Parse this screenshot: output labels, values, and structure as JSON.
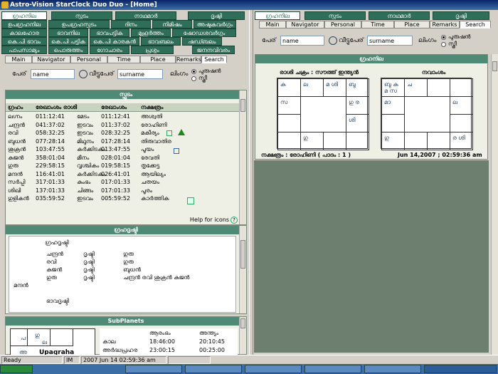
{
  "window": {
    "title": "Astro-Vision StarClock Duo Duo - [Home]"
  },
  "left": {
    "tabs_row1": [
      "ഗ്രഹനില",
      "സ്ഫുടം",
      "നാഥമാർ",
      "ദൃഷ്ടി"
    ],
    "tabs_row2": [
      "ഉപഗ്രഹനില",
      "ഉപഗ്രഹസ്ഫുടം",
      "ദിനം",
      "നിമിഷം",
      "അഷ്ടകവർഗ്ഗം"
    ],
    "tabs_row3": [
      "കാലഹോര",
      "ഭാവനില",
      "ഭാവപട്ടിക",
      "മുഹൂർത്തം",
      "ഷോഡശവർഗ്ഗം"
    ],
    "tabs_row4": [
      "കെ.പി ഭാവം",
      "കെ.പി പട്ടിക",
      "കെ.പി കാരകൻ",
      "ഭാവബലം",
      "ഷഡ്ബലം"
    ],
    "tabs_row5": [
      "പാപസാമ്യം",
      "പൊരുത്തം",
      "ഗോചാരം",
      "പ്രശ്നം",
      "ജനനവിവരം"
    ],
    "subtabs": [
      "Main",
      "Navigator",
      "Personal",
      "Time",
      "Place",
      "Remarks",
      "Search"
    ],
    "form": {
      "name_label": "പേര്",
      "name_value": "name",
      "surname_label": "വീട്ടുപേര്",
      "surname_value": "surname",
      "gender_label": "ലിംഗം",
      "male": "പുരുഷൻ",
      "female": "സ്ത്രീ"
    },
    "sphutam": {
      "title": "സ്ഫുടം",
      "headers": [
        "ഗ്രഹം",
        "രേഖാംശം രാശി",
        "",
        "രേഖാംശം",
        "നക്ഷത്രം"
      ],
      "rows": [
        [
          "ലഗ്നം",
          "011:12:41",
          "മേടം",
          "011:12:41",
          "അശ്വതി"
        ],
        [
          "ചന്ദ്രൻ",
          "041:37:02",
          "ഇടവം",
          "011:37:02",
          "രോഹിണി"
        ],
        [
          "രവി",
          "058:32:25",
          "ഇടവം",
          "028:32:25",
          "മകീര്യം"
        ],
        [
          "ബുധൻ",
          "077:28:14",
          "മിഥുനം",
          "017:28:14",
          "തിരുവാതിര"
        ],
        [
          "ശുക്രൻ",
          "103:47:55",
          "കർക്കിടകം",
          "013:47:55",
          "പൂയം"
        ],
        [
          "കുജൻ",
          "358:01:04",
          "മീനം",
          "028:01:04",
          "രേവതി"
        ],
        [
          "ഗുരു",
          "229:58:15",
          "വൃശ്ചികം",
          "019:58:15",
          "തൃക്കേട്ട"
        ],
        [
          "മന്ദൻ",
          "116:41:01",
          "കർക്കിടകം",
          "026:41:01",
          "ആയില്യം"
        ],
        [
          "സർപ്പി",
          "317:01:33",
          "കുംഭം",
          "017:01:33",
          "ചതയം"
        ],
        [
          "ശിഖി",
          "137:01:33",
          "ചിങ്ങം",
          "017:01:33",
          "പൂരം"
        ],
        [
          "ഗുളികൻ",
          "035:59:52",
          "ഇടവം",
          "005:59:52",
          "കാർത്തിക"
        ]
      ],
      "help": "Help for icons"
    },
    "drishti": {
      "title": "ഗ്രഹദൃഷ്ടി",
      "sub": "ഗ്രഹദൃഷ്ടി",
      "lines": [
        [
          "ചന്ദ്രൻ",
          "ദൃഷ്ടി",
          "ഗുരു"
        ],
        [
          "രവി",
          "ദൃഷ്ടി",
          "ഗുരു"
        ],
        [
          "കുജൻ",
          "ദൃഷ്ടി",
          "ബുധൻ"
        ],
        [
          "ഗുരു",
          "ദൃഷ്ടി",
          "ചന്ദ്രൻ രവി ശുക്രൻ കുജൻ"
        ]
      ],
      "extra": "മന്ദൻ",
      "bhava": "ഭാവദൃഷ്ടി"
    },
    "subplanets": {
      "title": "SubPlanets",
      "col1": "ആരംഭം",
      "col2": "അന്ത്യം",
      "rows": [
        [
          "കാല",
          "18:46:00",
          "20:10:45"
        ],
        [
          "അർദ്ധപ്രഹര",
          "23:00:15",
          "00:25:00"
        ]
      ],
      "mini": [
        "പ",
        "ഗു",
        "ല",
        "അ"
      ],
      "label": "Upagraha"
    }
  },
  "right": {
    "tabs_row1": [
      "ഗ്രഹനില",
      "സ്ഫുടം",
      "നാഥമാർ",
      "ദൃഷ്ടി"
    ],
    "subtabs": [
      "Main",
      "Navigator",
      "Personal",
      "Time",
      "Place",
      "Remarks",
      "Search"
    ],
    "form": {
      "name_label": "പേര്",
      "name_value": "name",
      "surname_label": "വീട്ടുപേര്",
      "surname_value": "surname",
      "gender_label": "ലിംഗം",
      "male": "പുരുഷൻ",
      "female": "സ്ത്രീ"
    },
    "grahanila": {
      "title": "ഗ്രഹനില",
      "rasi_label": "രാശി ചക്രം : സൗത്ത് ഇന്ത്യൻ",
      "navamsa_label": "നവാംശം",
      "rasi": {
        "c0": "കു",
        "c1": "ല",
        "c2": "മ ശി",
        "c3": "ബു",
        "c4": "സ",
        "c7": "ഗു ര",
        "c11": "ശി",
        "c13": "ഗു"
      },
      "navamsa": {
        "c0": "ബു കു മ സ",
        "c1": "ച",
        "c4": "മാ",
        "c7": "ല",
        "c12": "ഗു",
        "c14": "ര ശി"
      },
      "nakshatra": "നക്ഷത്രം : രോഹിണി ( പാദം : 1 )",
      "datetime": "Jun 14,2007 ; 02:59:36 am"
    }
  },
  "status": {
    "ready": "Ready",
    "im": "IM",
    "time": "2007 Jun 14 02:59:36 am"
  },
  "colors": {
    "tab": "#2f6e58",
    "header": "#4f8a76",
    "bg": "#6d8070"
  }
}
